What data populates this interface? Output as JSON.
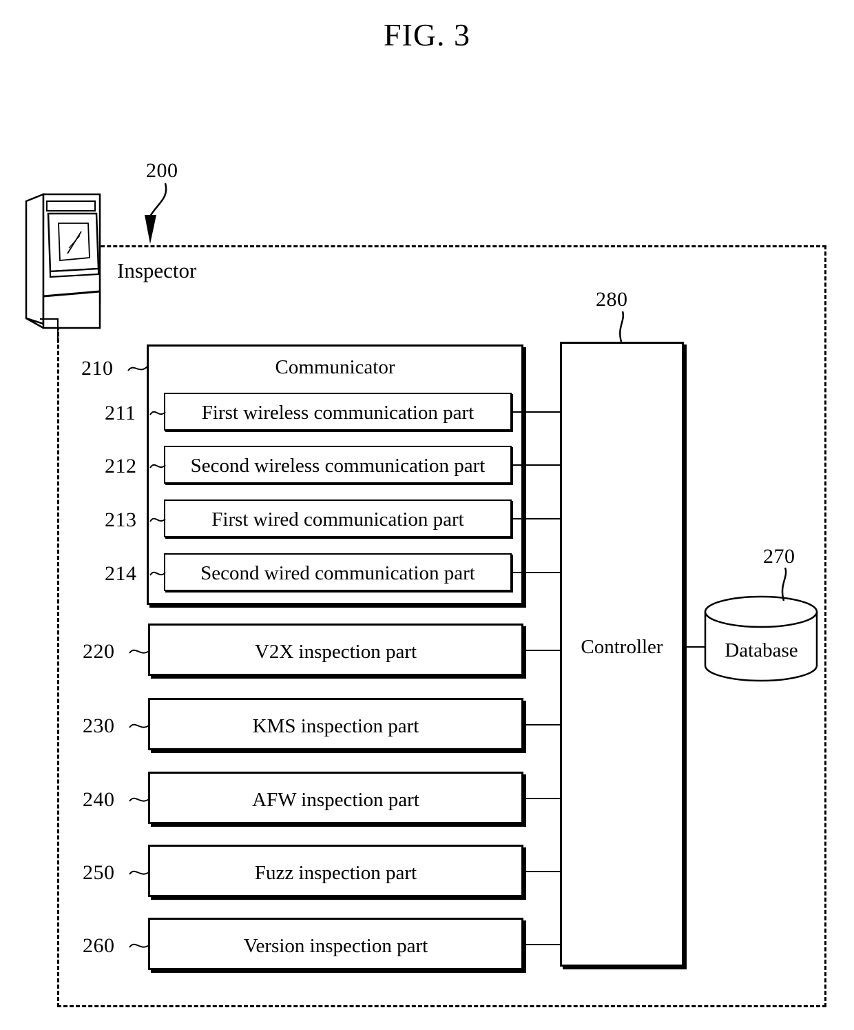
{
  "figure": {
    "title": "FIG. 3"
  },
  "system": {
    "ref": "200",
    "label": "Inspector"
  },
  "communicator": {
    "ref": "210",
    "label": "Communicator",
    "parts": [
      {
        "ref": "211",
        "label": "First wireless communication part"
      },
      {
        "ref": "212",
        "label": "Second wireless communication part"
      },
      {
        "ref": "213",
        "label": "First wired communication part"
      },
      {
        "ref": "214",
        "label": "Second wired communication part"
      }
    ]
  },
  "inspection_parts": [
    {
      "ref": "220",
      "label": "V2X inspection part"
    },
    {
      "ref": "230",
      "label": "KMS inspection part"
    },
    {
      "ref": "240",
      "label": "AFW inspection part"
    },
    {
      "ref": "250",
      "label": "Fuzz inspection part"
    },
    {
      "ref": "260",
      "label": "Version inspection part"
    }
  ],
  "controller": {
    "ref": "280",
    "label": "Controller"
  },
  "database": {
    "ref": "270",
    "label": "Database"
  }
}
